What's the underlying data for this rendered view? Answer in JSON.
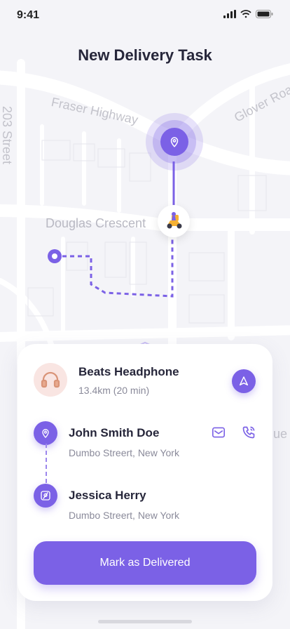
{
  "status_bar": {
    "time": "9:41"
  },
  "header": {
    "title": "New Delivery Task"
  },
  "map": {
    "streets": {
      "fraser": "Fraser Highway",
      "glover": "Glover Road",
      "s203": "203 Street",
      "douglas": "Douglas Crescent",
      "partial": "ue"
    }
  },
  "task": {
    "product": {
      "name": "Beats Headphone",
      "distance": "13.4km (20 min)"
    },
    "sender": {
      "name": "John Smith Doe",
      "address": "Dumbo Streert, New York"
    },
    "recipient": {
      "name": "Jessica Herry",
      "address": "Dumbo Streert, New York"
    },
    "cta_label": "Mark as Delivered"
  },
  "colors": {
    "accent": "#7B61E6",
    "background": "#F4F4F8",
    "text": "#26263A",
    "muted": "#8A8A9A"
  }
}
